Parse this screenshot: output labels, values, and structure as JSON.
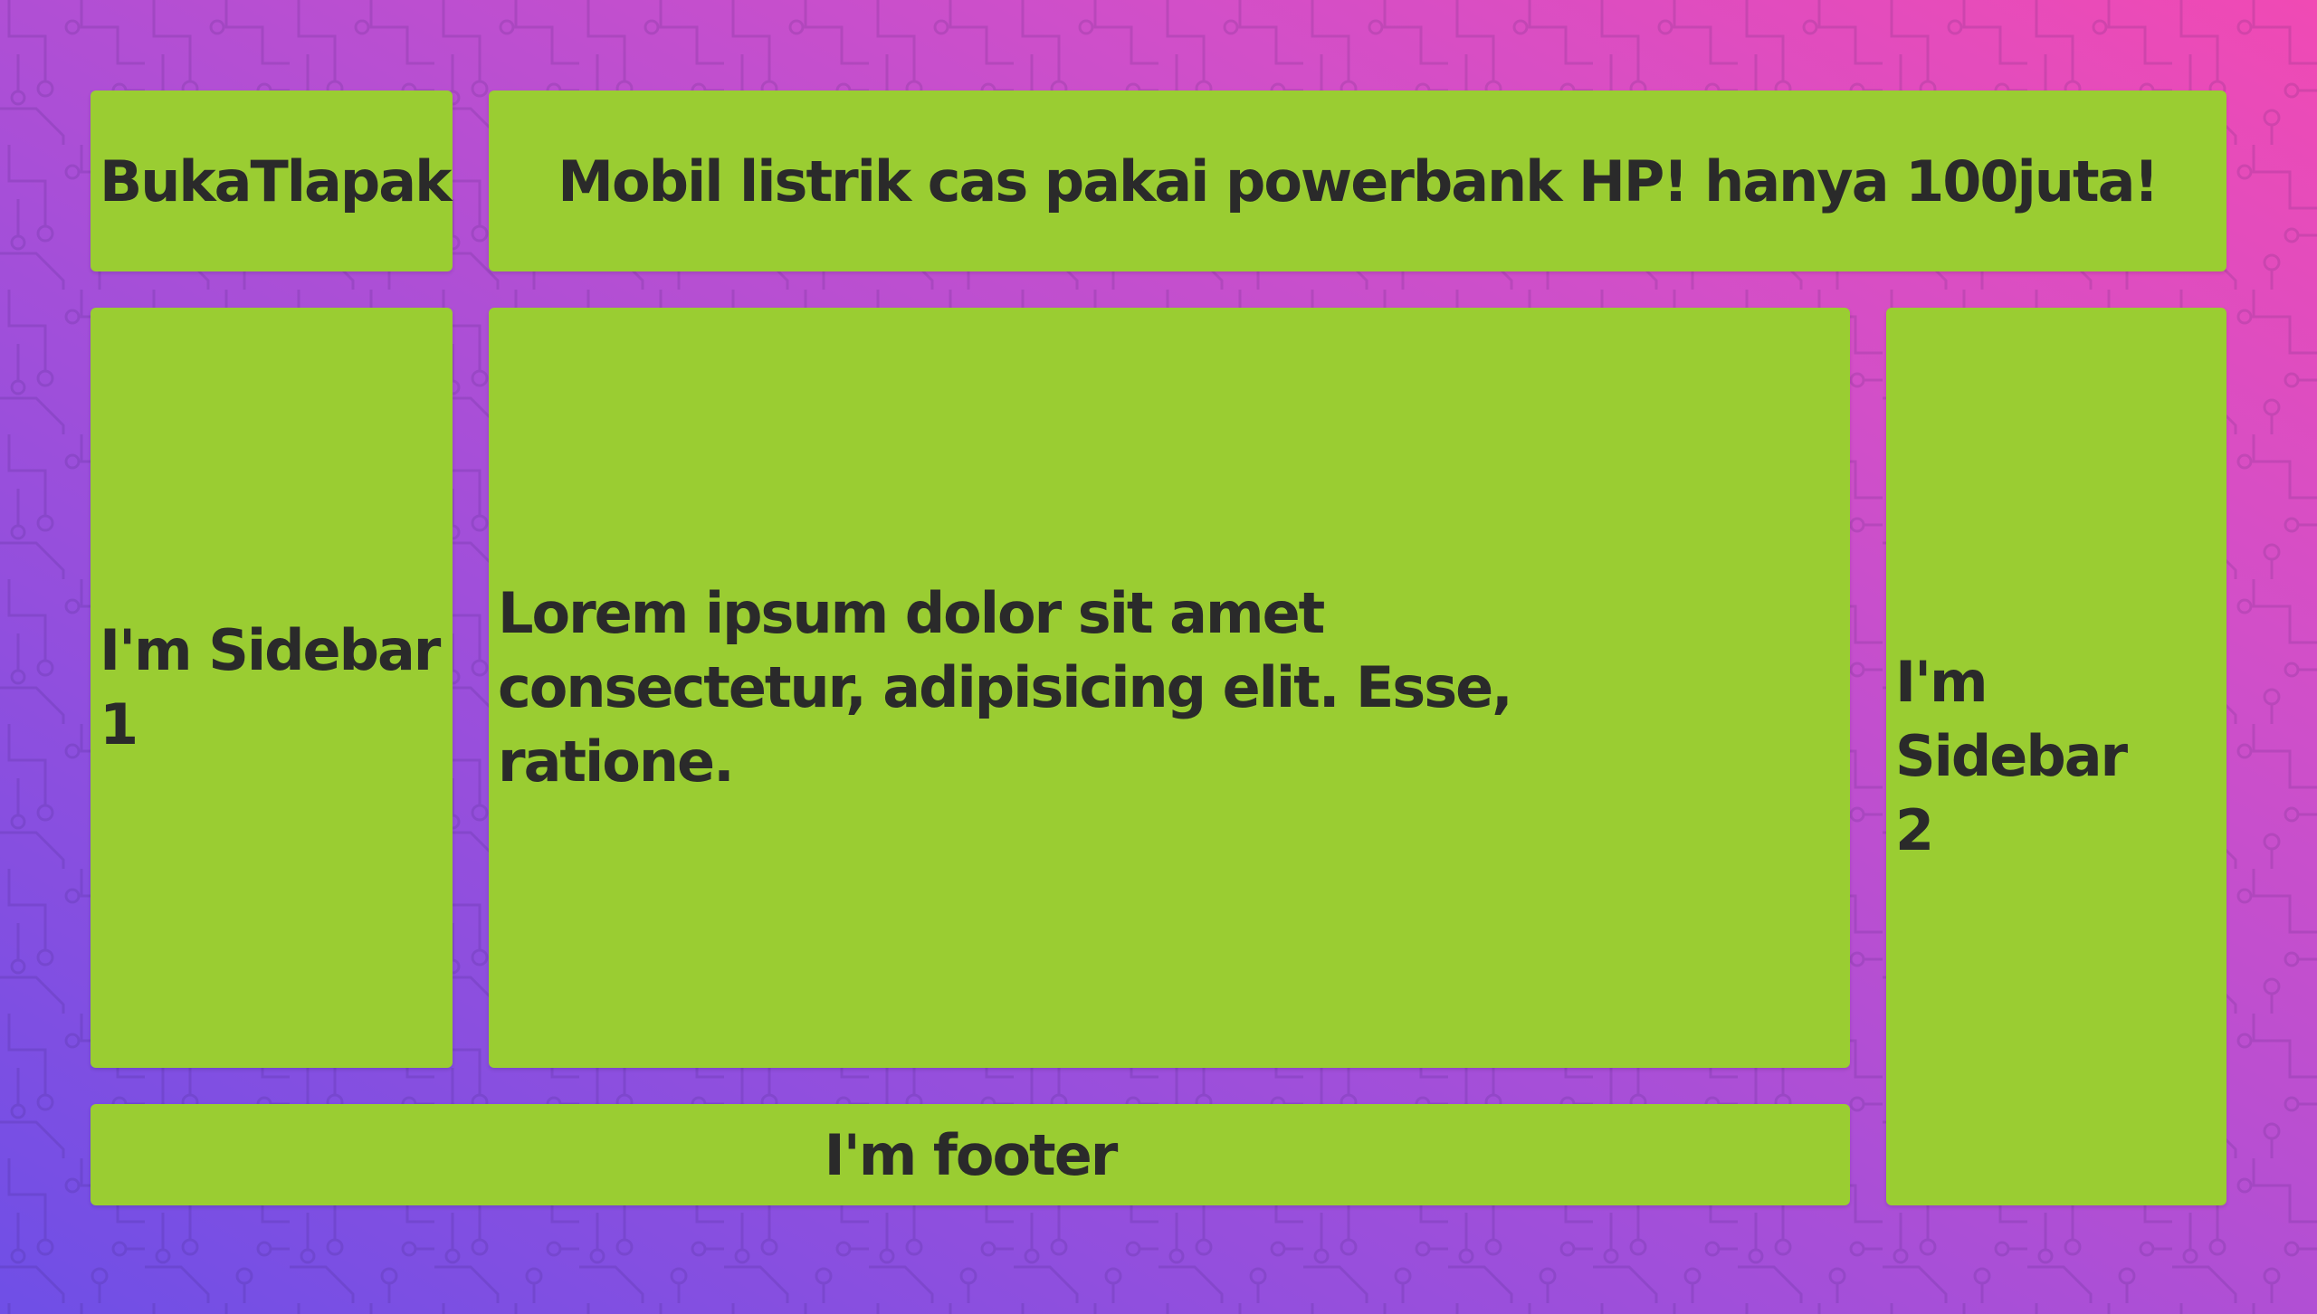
{
  "logo": {
    "text": "BukaTlapak"
  },
  "header": {
    "text": "Mobil listrik cas pakai powerbank HP! hanya 100juta!"
  },
  "sidebar1": {
    "text": "I'm Sidebar 1"
  },
  "main": {
    "text": "Lorem ipsum dolor sit amet consectetur, adipisicing elit. Esse, ratione."
  },
  "sidebar2": {
    "text": "I'm Sidebar 2"
  },
  "footer": {
    "text": "I'm footer"
  },
  "colors": {
    "box": "#9acd32",
    "text": "#2a2a2a",
    "background_start": "#6f4fe6",
    "background_end": "#f04ab4"
  }
}
